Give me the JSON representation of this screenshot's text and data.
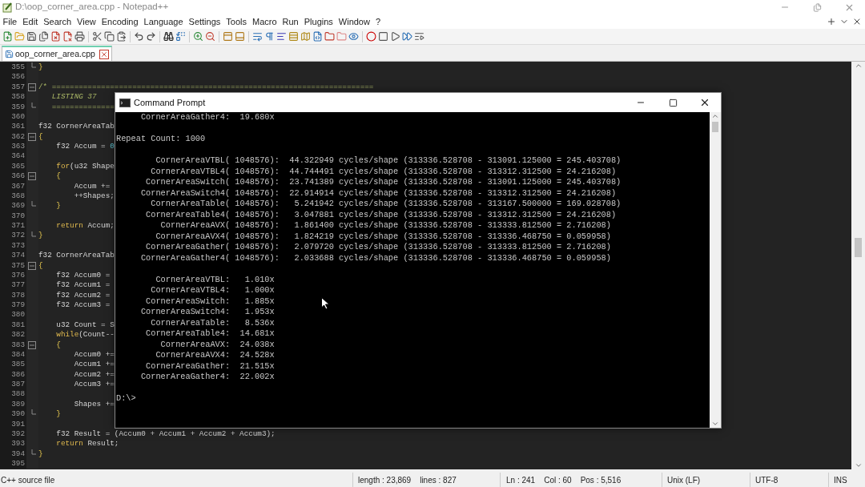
{
  "window": {
    "title": "D:\\oop_corner_area.cpp - Notepad++"
  },
  "menu": [
    "File",
    "Edit",
    "Search",
    "View",
    "Encoding",
    "Language",
    "Settings",
    "Tools",
    "Macro",
    "Run",
    "Plugins",
    "Window",
    "?"
  ],
  "tabs": [
    {
      "label": "oop_corner_area.cpp",
      "selected": true
    }
  ],
  "editor": {
    "lines": [
      {
        "number": "355",
        "fold_open": false,
        "fold_close": true,
        "code": [
          {
            "kind": "brace",
            "text": "}"
          }
        ]
      },
      {
        "number": "356",
        "fold_open": false,
        "fold_close": false
      },
      {
        "number": "357",
        "fold_open": true,
        "fold_close": false,
        "code": [
          {
            "kind": "comment",
            "text": "/* ========================================================================"
          }
        ]
      },
      {
        "number": "358",
        "fold_open": false,
        "fold_close": false,
        "code": [
          {
            "kind": "comment_italic",
            "text": "   LISTING 37"
          }
        ]
      },
      {
        "number": "359",
        "fold_open": false,
        "fold_close": true,
        "code": [
          {
            "kind": "comment",
            "text": "   =============="
          }
        ]
      },
      {
        "number": "360",
        "fold_open": false,
        "fold_close": false
      },
      {
        "number": "361",
        "fold_open": false,
        "fold_close": false,
        "code": [
          {
            "kind": "plain",
            "text": "f32 CornerAreaTab"
          }
        ]
      },
      {
        "number": "362",
        "fold_open": true,
        "fold_close": false,
        "code": [
          {
            "kind": "brace",
            "text": "{"
          }
        ]
      },
      {
        "number": "363",
        "fold_open": false,
        "fold_close": false,
        "code": [
          {
            "kind": "plain",
            "text": "    f32 Accum = "
          },
          {
            "kind": "number",
            "text": "0"
          }
        ]
      },
      {
        "number": "364",
        "fold_open": false,
        "fold_close": false
      },
      {
        "number": "365",
        "fold_open": false,
        "fold_close": false,
        "code": [
          {
            "kind": "keyword",
            "text": "    for"
          },
          {
            "kind": "plain",
            "text": "(u32 Shape"
          }
        ]
      },
      {
        "number": "366",
        "fold_open": true,
        "fold_close": false,
        "code": [
          {
            "kind": "brace",
            "text": "    {"
          }
        ]
      },
      {
        "number": "367",
        "fold_open": false,
        "fold_close": false,
        "code": [
          {
            "kind": "plain",
            "text": "        Accum +="
          }
        ]
      },
      {
        "number": "368",
        "fold_open": false,
        "fold_close": false,
        "code": [
          {
            "kind": "plain",
            "text": "        ++Shapes;"
          }
        ]
      },
      {
        "number": "369",
        "fold_open": false,
        "fold_close": true,
        "code": [
          {
            "kind": "brace",
            "text": "    }"
          }
        ]
      },
      {
        "number": "370",
        "fold_open": false,
        "fold_close": false
      },
      {
        "number": "371",
        "fold_open": false,
        "fold_close": false,
        "code": [
          {
            "kind": "keyword",
            "text": "    return"
          },
          {
            "kind": "plain",
            "text": " Accum;"
          }
        ]
      },
      {
        "number": "372",
        "fold_open": false,
        "fold_close": true,
        "code": [
          {
            "kind": "brace",
            "text": "}"
          }
        ]
      },
      {
        "number": "373",
        "fold_open": false,
        "fold_close": false
      },
      {
        "number": "374",
        "fold_open": false,
        "fold_close": false,
        "code": [
          {
            "kind": "plain",
            "text": "f32 CornerAreaTab"
          }
        ]
      },
      {
        "number": "375",
        "fold_open": true,
        "fold_close": false,
        "code": [
          {
            "kind": "brace",
            "text": "{"
          }
        ]
      },
      {
        "number": "376",
        "fold_open": false,
        "fold_close": false,
        "code": [
          {
            "kind": "plain",
            "text": "    f32 Accum0 ="
          }
        ]
      },
      {
        "number": "377",
        "fold_open": false,
        "fold_close": false,
        "code": [
          {
            "kind": "plain",
            "text": "    f32 Accum1 ="
          }
        ]
      },
      {
        "number": "378",
        "fold_open": false,
        "fold_close": false,
        "code": [
          {
            "kind": "plain",
            "text": "    f32 Accum2 ="
          }
        ]
      },
      {
        "number": "379",
        "fold_open": false,
        "fold_close": false,
        "code": [
          {
            "kind": "plain",
            "text": "    f32 Accum3 ="
          }
        ]
      },
      {
        "number": "380",
        "fold_open": false,
        "fold_close": false
      },
      {
        "number": "381",
        "fold_open": false,
        "fold_close": false,
        "code": [
          {
            "kind": "plain",
            "text": "    u32 Count = S"
          }
        ]
      },
      {
        "number": "382",
        "fold_open": false,
        "fold_close": false,
        "code": [
          {
            "kind": "keyword",
            "text": "    while"
          },
          {
            "kind": "plain",
            "text": "(Count--"
          }
        ]
      },
      {
        "number": "383",
        "fold_open": true,
        "fold_close": false,
        "code": [
          {
            "kind": "brace",
            "text": "    {"
          }
        ]
      },
      {
        "number": "384",
        "fold_open": false,
        "fold_close": false,
        "code": [
          {
            "kind": "plain",
            "text": "        Accum0 +="
          }
        ]
      },
      {
        "number": "385",
        "fold_open": false,
        "fold_close": false,
        "code": [
          {
            "kind": "plain",
            "text": "        Accum1 +="
          }
        ]
      },
      {
        "number": "386",
        "fold_open": false,
        "fold_close": false,
        "code": [
          {
            "kind": "plain",
            "text": "        Accum2 +="
          }
        ]
      },
      {
        "number": "387",
        "fold_open": false,
        "fold_close": false,
        "code": [
          {
            "kind": "plain",
            "text": "        Accum3 +="
          }
        ]
      },
      {
        "number": "388",
        "fold_open": false,
        "fold_close": false
      },
      {
        "number": "389",
        "fold_open": false,
        "fold_close": false,
        "code": [
          {
            "kind": "plain",
            "text": "        Shapes +="
          }
        ]
      },
      {
        "number": "390",
        "fold_open": false,
        "fold_close": true,
        "code": [
          {
            "kind": "brace",
            "text": "    }"
          }
        ]
      },
      {
        "number": "391",
        "fold_open": false,
        "fold_close": false
      },
      {
        "number": "392",
        "fold_open": false,
        "fold_close": false,
        "code": [
          {
            "kind": "plain",
            "text": "    f32 Result = (Accum0 + Accum1 + Accum2 + Accum3);"
          }
        ]
      },
      {
        "number": "393",
        "fold_open": false,
        "fold_close": false,
        "code": [
          {
            "kind": "keyword",
            "text": "    return"
          },
          {
            "kind": "plain",
            "text": " Result;"
          }
        ]
      },
      {
        "number": "394",
        "fold_open": false,
        "fold_close": true,
        "code": [
          {
            "kind": "brace",
            "text": "}"
          }
        ]
      },
      {
        "number": "395",
        "fold_open": false,
        "fold_close": false
      }
    ]
  },
  "console": {
    "title": "Command Prompt",
    "blocks": [
      [
        "     CornerAreaGather4:  19.680x"
      ],
      [
        "Repeat Count: 1000"
      ],
      [
        "        CornerAreaVTBL( 1048576):  44.322949 cycles/shape (313336.528708 - 313091.125000 = 245.403708)",
        "       CornerAreaVTBL4( 1048576):  44.744491 cycles/shape (313336.528708 - 313312.312500 = 24.216208)",
        "      CornerAreaSwitch( 1048576):  23.741389 cycles/shape (313336.528708 - 313091.125000 = 245.403708)",
        "     CornerAreaSwitch4( 1048576):  22.914914 cycles/shape (313336.528708 - 313312.312500 = 24.216208)",
        "       CornerAreaTable( 1048576):   5.241942 cycles/shape (313336.528708 - 313167.500000 = 169.028708)",
        "      CornerAreaTable4( 1048576):   3.047881 cycles/shape (313336.528708 - 313312.312500 = 24.216208)",
        "         CornerAreaAVX( 1048576):   1.861400 cycles/shape (313336.528708 - 313333.812500 = 2.716208)",
        "        CornerAreaAVX4( 1048576):   1.824219 cycles/shape (313336.528708 - 313336.468750 = 0.059958)",
        "      CornerAreaGather( 1048576):   2.079720 cycles/shape (313336.528708 - 313333.812500 = 2.716208)",
        "     CornerAreaGather4( 1048576):   2.033688 cycles/shape (313336.528708 - 313336.468750 = 0.059958)"
      ],
      [
        "        CornerAreaVTBL:   1.010x",
        "       CornerAreaVTBL4:   1.000x",
        "      CornerAreaSwitch:   1.885x",
        "     CornerAreaSwitch4:   1.953x",
        "       CornerAreaTable:   8.536x",
        "      CornerAreaTable4:  14.681x",
        "         CornerAreaAVX:  24.038x",
        "        CornerAreaAVX4:  24.528x",
        "      CornerAreaGather:  21.515x",
        "     CornerAreaGather4:  22.002x"
      ],
      [
        "D:\\>"
      ]
    ]
  },
  "status_bar": {
    "file_type": "C++ source file",
    "length": "length : 23,869",
    "lines": "lines : 827",
    "ln": "Ln : 241",
    "col": "Col : 60",
    "pos": "Pos : 5,516",
    "eol": "Unix (LF)",
    "encoding": "UTF-8",
    "mode": "INS"
  }
}
